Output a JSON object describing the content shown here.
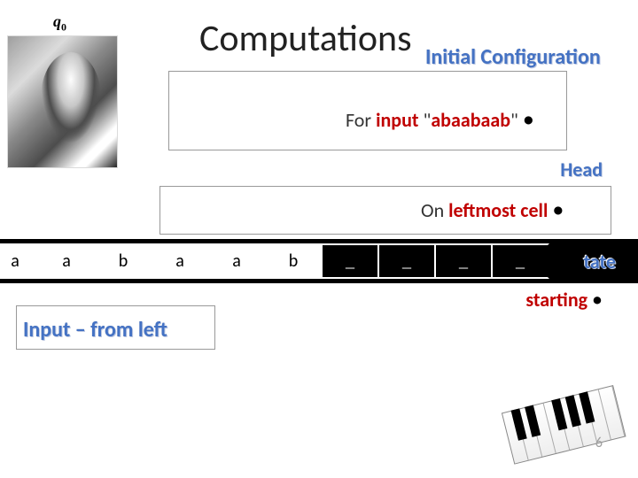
{
  "state_symbol": "q",
  "state_sub": "0",
  "title": "Computations",
  "subtitle": "Initial Configuration",
  "line1": {
    "for": "For ",
    "input": "input",
    "q1": " \"",
    "word": "abaabaab",
    "q2": "\" ",
    "bullet": "•"
  },
  "head_label": "Head",
  "line2": {
    "on": "On ",
    "leftmost": "leftmost cell",
    "sp": " ",
    "bullet": "•"
  },
  "tape": [
    "a",
    "a",
    "b",
    "a",
    "a",
    "b",
    "_",
    "_",
    "_",
    "_"
  ],
  "state_label": "tate",
  "starting": {
    "word": "starting",
    "sp": " ",
    "bullet": "•"
  },
  "input_from_left": "Input – from left",
  "page_num": "6"
}
